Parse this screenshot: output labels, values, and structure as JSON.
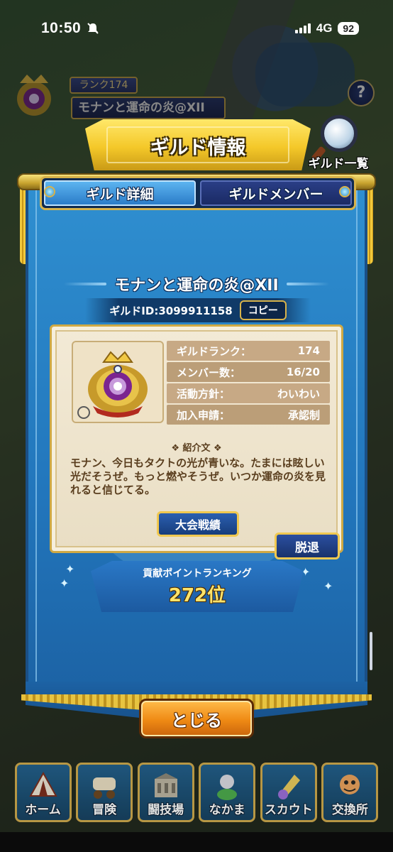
{
  "status_bar": {
    "time": "10:50",
    "network": "4G",
    "battery": "92"
  },
  "background": {
    "rank_label": "ランク174",
    "guild_name": "モナンと運命の炎@XII"
  },
  "modal": {
    "title": "ギルド情報",
    "guild_list_label": "ギルド一覧",
    "tabs": [
      {
        "label": "ギルド詳細",
        "active": true
      },
      {
        "label": "ギルドメンバー",
        "active": false
      }
    ],
    "guild_name": "モナンと運命の炎@XII",
    "guild_id_text": "ギルドID:3099911158",
    "copy_label": "コピー",
    "stats": [
      {
        "label": "ギルドランク：",
        "value": "174"
      },
      {
        "label": "メンバー数：",
        "value": "16/20"
      },
      {
        "label": "活動方針：",
        "value": "わいわい"
      },
      {
        "label": "加入申請：",
        "value": "承認制"
      }
    ],
    "intro_label": "❖ 紹介文 ❖",
    "intro_text": "モナン、今日もタクトの光が青いな。たまには眩しい光だそうぜ。もっと燃やそうぜ。いつか運命の炎を見れると信じてる。",
    "tournament_button": "大会戦績",
    "leave_button": "脱退",
    "ranking_title": "貢献ポイントランキング",
    "ranking_value": "272位",
    "close_button": "とじる"
  },
  "bottom_nav": [
    {
      "label": "ホーム",
      "icon": "tent-icon"
    },
    {
      "label": "冒険",
      "icon": "wagon-icon"
    },
    {
      "label": "闘技場",
      "icon": "arena-icon"
    },
    {
      "label": "なかま",
      "icon": "party-icon"
    },
    {
      "label": "スカウト",
      "icon": "scout-icon"
    },
    {
      "label": "交換所",
      "icon": "exchange-icon"
    }
  ],
  "colors": {
    "banner_blue": "#2276bc",
    "gold": "#d7b24a",
    "parchment": "#f3ead6",
    "close_orange": "#ef8a14",
    "rank_yellow": "#ffe36a"
  }
}
